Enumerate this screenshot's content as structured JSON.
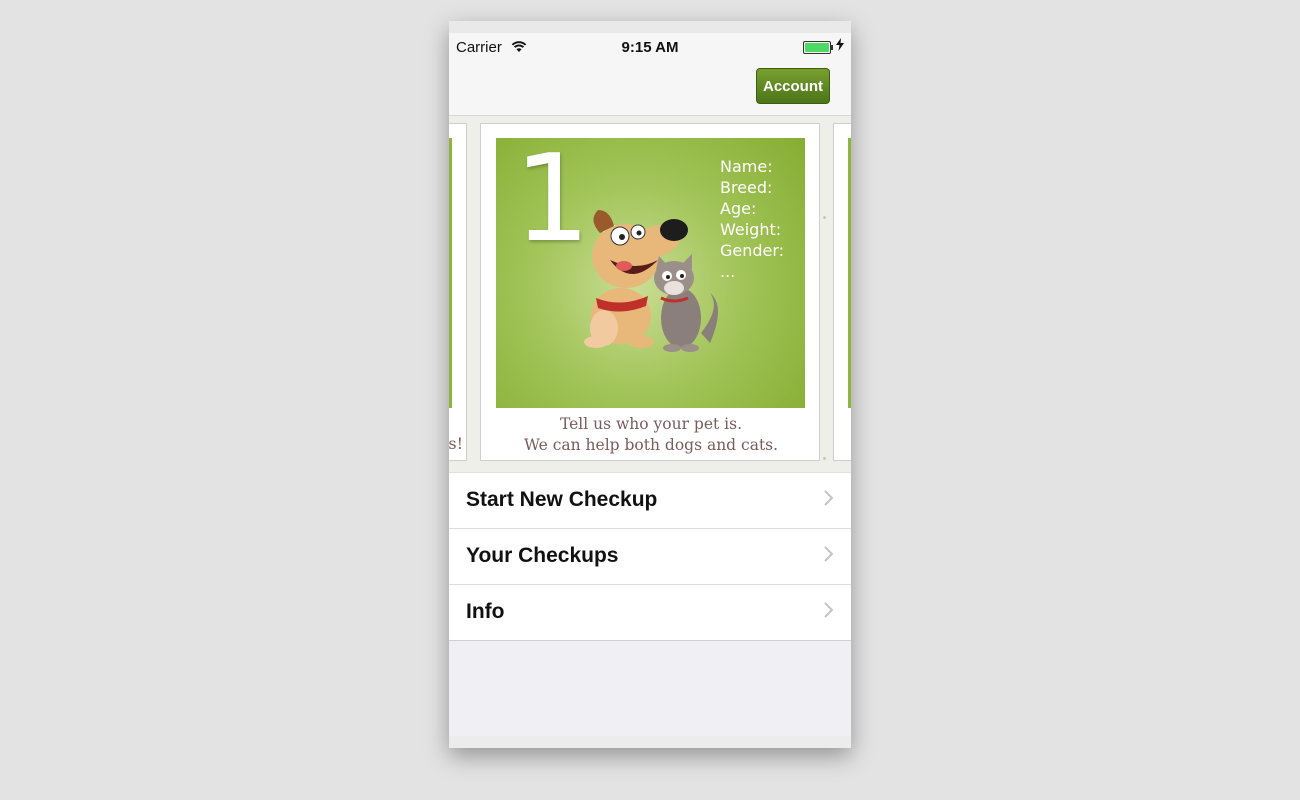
{
  "status_bar": {
    "carrier": "Carrier",
    "time": "9:15 AM",
    "wifi_icon": "wifi-icon",
    "battery_icon": "battery-icon"
  },
  "navbar": {
    "account_label": "Account",
    "accent_color": "#5e8a20"
  },
  "carousel": {
    "left_card_tail": "os!",
    "current_card": {
      "step": "1.",
      "fields": [
        "Name:",
        "Breed:",
        "Age:",
        "Weight:",
        "Gender:",
        "..."
      ],
      "caption_line1": "Tell us who your pet is.",
      "caption_line2": "We can help both dogs and cats.",
      "illustration": "dog-and-cat-illustration"
    }
  },
  "menu": {
    "items": [
      {
        "label": "Start New Checkup",
        "icon": "chevron-right-icon"
      },
      {
        "label": "Your Checkups",
        "icon": "chevron-right-icon"
      },
      {
        "label": "Info",
        "icon": "chevron-right-icon"
      }
    ]
  }
}
